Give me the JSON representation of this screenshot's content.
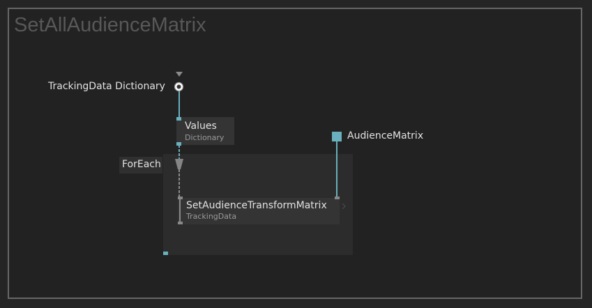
{
  "patch": {
    "title": "SetAllAudienceMatrix"
  },
  "nodes": {
    "tracking_input": {
      "label": "TrackingData Dictionary"
    },
    "values": {
      "label": "Values",
      "sublabel": "Dictionary"
    },
    "foreach": {
      "label": "ForEach"
    },
    "audience_matrix": {
      "label": "AudienceMatrix"
    },
    "set_transform": {
      "label": "SetAudienceTransformMatrix",
      "sublabel": "TrackingData"
    }
  },
  "colors": {
    "link": "#6ab0be",
    "background": "#222222",
    "region": "#2c2c2c",
    "node": "#343434"
  }
}
